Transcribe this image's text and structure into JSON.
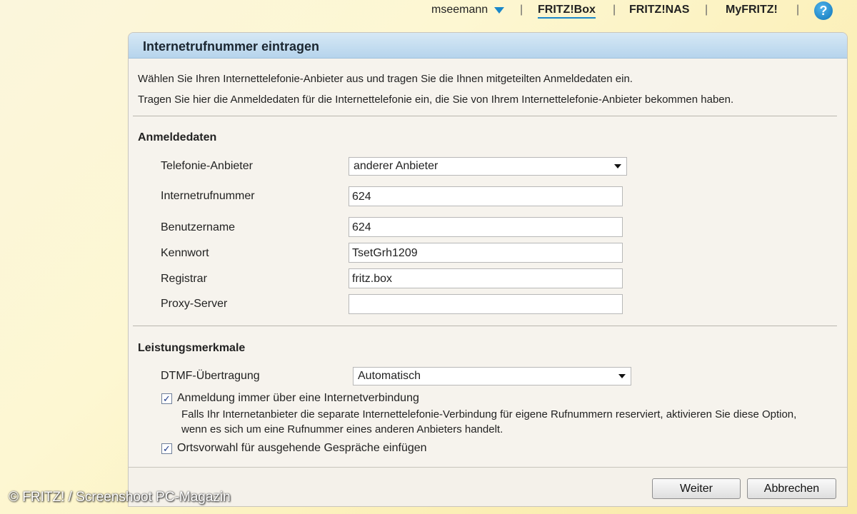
{
  "topnav": {
    "user": "mseemann",
    "links": [
      "FRITZ!Box",
      "FRITZ!NAS",
      "MyFRITZ!"
    ],
    "separator": "|",
    "help_glyph": "?"
  },
  "panel": {
    "title": "Internetrufnummer eintragen",
    "intro_1": "Wählen Sie Ihren Internettelefonie-Anbieter aus und tragen Sie die Ihnen mitgeteilten Anmeldedaten ein.",
    "intro_2": "Tragen Sie hier die Anmeldedaten für die Internettelefonie ein, die Sie von Ihrem Internettelefonie-Anbieter bekommen haben."
  },
  "login": {
    "section_title": "Anmeldedaten",
    "provider_label": "Telefonie-Anbieter",
    "provider_value": "anderer Anbieter",
    "number_label": "Internetrufnummer",
    "number_value": "624",
    "username_label": "Benutzername",
    "username_value": "624",
    "password_label": "Kennwort",
    "password_value": "TsetGrh1209",
    "registrar_label": "Registrar",
    "registrar_value": "fritz.box",
    "proxy_label": "Proxy-Server",
    "proxy_value": ""
  },
  "features": {
    "section_title": "Leistungsmerkmale",
    "dtmf_label": "DTMF-Übertragung",
    "dtmf_value": "Automatisch",
    "cb1_label": "Anmeldung immer über eine Internetverbindung",
    "cb1_checked": true,
    "cb1_desc": "Falls Ihr Internetanbieter die separate Internettelefonie-Verbindung für eigene Rufnummern reserviert, aktivieren Sie diese Option, wenn es sich um eine Rufnummer eines anderen Anbieters handelt.",
    "cb2_label": "Ortsvorwahl für ausgehende Gespräche einfügen",
    "cb2_checked": true,
    "check_glyph": "✓"
  },
  "buttons": {
    "next": "Weiter",
    "cancel": "Abbrechen"
  },
  "watermark": "© FRITZ! / Screenshoot PC-Magazin",
  "colors": {
    "accent": "#1a87c9",
    "header_bg": "#c4dcef"
  }
}
